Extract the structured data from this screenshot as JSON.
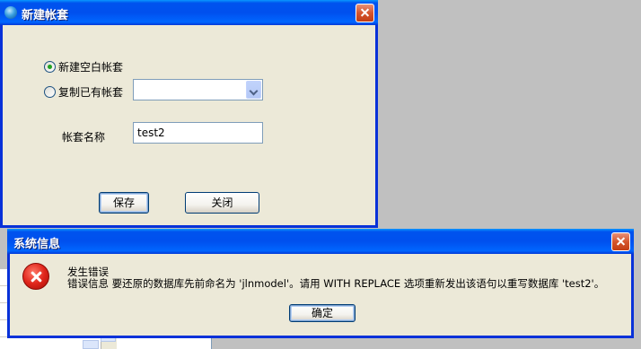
{
  "dialog_new": {
    "title": "新建帐套",
    "radio_new_label": "新建空白帐套",
    "radio_copy_label": "复制已有帐套",
    "copy_select_value": "",
    "name_label": "帐套名称",
    "name_value": "test2",
    "save_label": "保存",
    "close_label": "关闭",
    "selected_option": "新建空白帐套"
  },
  "dialog_error": {
    "title": "系统信息",
    "heading": "发生错误",
    "message": "错误信息 要还原的数据库先前命名为 'jlnmodel'。请用 WITH REPLACE 选项重新发出该语句以重写数据库 'test2'。",
    "ok_label": "确定",
    "icon": "error-icon"
  },
  "colors": {
    "titlebar_blue": "#0054e3",
    "dialog_bg": "#ece9d8",
    "close_red": "#d5552d",
    "desktop_gray": "#c0c0c0"
  }
}
